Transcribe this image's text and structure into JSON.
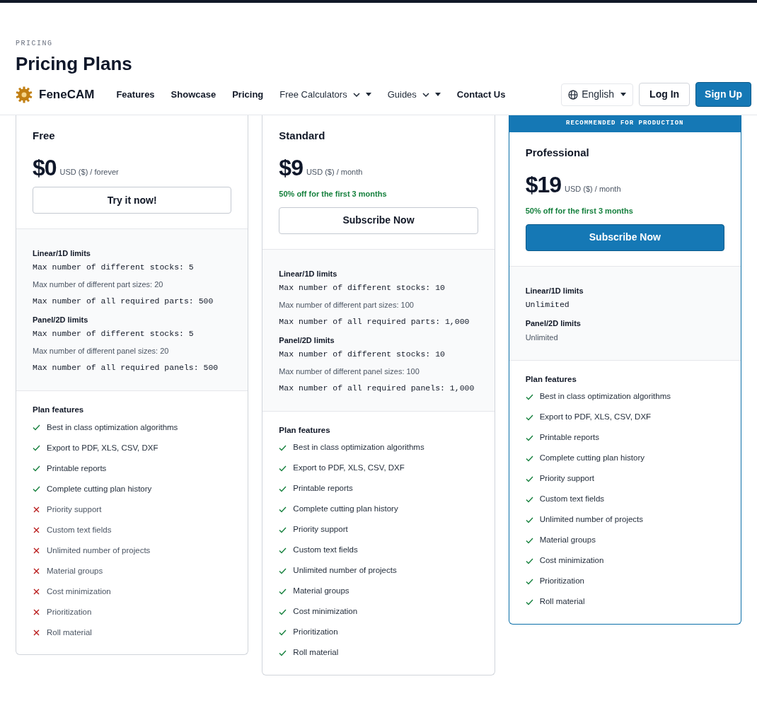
{
  "eyebrow": "PRICING",
  "title": "Pricing Plans",
  "nav": {
    "brand": "FeneCAM",
    "links": [
      {
        "label": "Features",
        "kind": "link"
      },
      {
        "label": "Showcase",
        "kind": "link"
      },
      {
        "label": "Pricing",
        "kind": "link"
      },
      {
        "label": "Free Calculators",
        "kind": "dropdown"
      },
      {
        "label": "Guides",
        "kind": "dropdown"
      },
      {
        "label": "Contact Us",
        "kind": "link"
      }
    ],
    "language": "English",
    "login": "Log In",
    "signup": "Sign Up"
  },
  "plans": [
    {
      "name": "Free",
      "price": "$0",
      "period": "USD ($) / forever",
      "button": "Try it now!",
      "featured": false,
      "limits": [
        {
          "heading": "Linear/1D limits",
          "lines": [
            {
              "text": "Max number of different stocks: 5",
              "kind": "mono"
            },
            {
              "text": "Max number of different part sizes: 20",
              "kind": "plain"
            },
            {
              "text": "Max number of all required parts: 500",
              "kind": "mono"
            }
          ]
        },
        {
          "heading": "Panel/2D limits",
          "lines": [
            {
              "text": "Max number of different stocks: 5",
              "kind": "mono"
            },
            {
              "text": "Max number of different panel sizes: 20",
              "kind": "plain"
            },
            {
              "text": "Max number of all required panels: 500",
              "kind": "mono"
            }
          ]
        }
      ],
      "features_heading": "Plan features",
      "features": [
        {
          "label": "Best in class optimization algorithms",
          "included": true
        },
        {
          "label": "Export to PDF, XLS, CSV, DXF",
          "included": true
        },
        {
          "label": "Printable reports",
          "included": true
        },
        {
          "label": "Complete cutting plan history",
          "included": true
        },
        {
          "label": "Priority support",
          "included": false
        },
        {
          "label": "Custom text fields",
          "included": false
        },
        {
          "label": "Unlimited number of projects",
          "included": false
        },
        {
          "label": "Material groups",
          "included": false
        },
        {
          "label": "Cost minimization",
          "included": false
        },
        {
          "label": "Prioritization",
          "included": false
        },
        {
          "label": "Roll material",
          "included": false
        }
      ]
    },
    {
      "name": "Standard",
      "price": "$9",
      "period": "USD ($) / month",
      "discount": "50% off for the first 3 months",
      "button": "Subscribe Now",
      "featured": false,
      "limits": [
        {
          "heading": "Linear/1D limits",
          "lines": [
            {
              "text": "Max number of different stocks: 10",
              "kind": "mono"
            },
            {
              "text": "Max number of different part sizes: 100",
              "kind": "plain"
            },
            {
              "text": "Max number of all required parts: 1,000",
              "kind": "mono"
            }
          ]
        },
        {
          "heading": "Panel/2D limits",
          "lines": [
            {
              "text": "Max number of different stocks: 10",
              "kind": "mono"
            },
            {
              "text": "Max number of different panel sizes: 100",
              "kind": "plain"
            },
            {
              "text": "Max number of all required panels: 1,000",
              "kind": "mono"
            }
          ]
        }
      ],
      "features_heading": "Plan features",
      "features": [
        {
          "label": "Best in class optimization algorithms",
          "included": true
        },
        {
          "label": "Export to PDF, XLS, CSV, DXF",
          "included": true
        },
        {
          "label": "Printable reports",
          "included": true
        },
        {
          "label": "Complete cutting plan history",
          "included": true
        },
        {
          "label": "Priority support",
          "included": true
        },
        {
          "label": "Custom text fields",
          "included": true
        },
        {
          "label": "Unlimited number of projects",
          "included": true
        },
        {
          "label": "Material groups",
          "included": true
        },
        {
          "label": "Cost minimization",
          "included": true
        },
        {
          "label": "Prioritization",
          "included": true
        },
        {
          "label": "Roll material",
          "included": true
        }
      ]
    },
    {
      "name": "Professional",
      "banner": "RECOMMENDED FOR PRODUCTION",
      "price": "$19",
      "period": "USD ($) / month",
      "discount": "50% off for the first 3 months",
      "button": "Subscribe Now",
      "featured": true,
      "limits": [
        {
          "heading": "Linear/1D limits",
          "lines": [
            {
              "text": "Unlimited",
              "kind": "mono"
            }
          ]
        },
        {
          "heading": "Panel/2D limits",
          "lines": [
            {
              "text": "Unlimited",
              "kind": "plain"
            }
          ]
        }
      ],
      "features_heading": "Plan features",
      "features": [
        {
          "label": "Best in class optimization algorithms",
          "included": true
        },
        {
          "label": "Export to PDF, XLS, CSV, DXF",
          "included": true
        },
        {
          "label": "Printable reports",
          "included": true
        },
        {
          "label": "Complete cutting plan history",
          "included": true
        },
        {
          "label": "Priority support",
          "included": true
        },
        {
          "label": "Custom text fields",
          "included": true
        },
        {
          "label": "Unlimited number of projects",
          "included": true
        },
        {
          "label": "Material groups",
          "included": true
        },
        {
          "label": "Cost minimization",
          "included": true
        },
        {
          "label": "Prioritization",
          "included": true
        },
        {
          "label": "Roll material",
          "included": true
        }
      ]
    }
  ]
}
